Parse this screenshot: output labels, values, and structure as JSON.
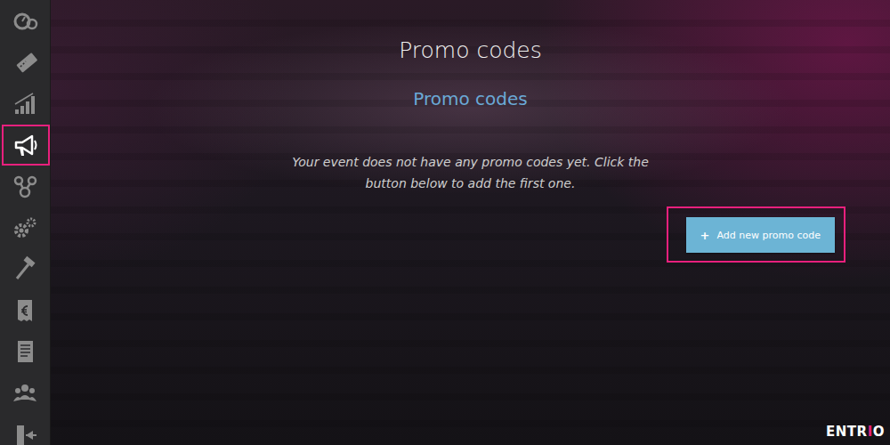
{
  "sidebar": {
    "items": [
      {
        "selected": false
      },
      {
        "selected": false
      },
      {
        "selected": false
      },
      {
        "selected": true
      },
      {
        "selected": false
      },
      {
        "selected": false
      },
      {
        "selected": false
      },
      {
        "selected": false
      },
      {
        "selected": false
      },
      {
        "selected": false
      },
      {
        "selected": false
      }
    ]
  },
  "page": {
    "title": "Promo codes",
    "subtitle": "Promo codes",
    "message": "Your event does not have any promo codes yet. Click the button below to add the first one."
  },
  "add_button": {
    "icon": "+",
    "label": "Add new promo code",
    "highlighted": true
  },
  "logo": {
    "parts": [
      "ENTR",
      "I",
      "O"
    ]
  }
}
